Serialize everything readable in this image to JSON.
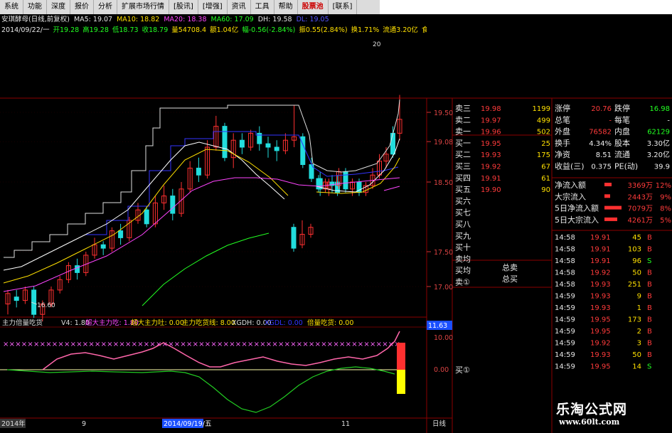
{
  "menu": {
    "items": [
      "系统",
      "功能",
      "深度",
      "报价",
      "分析",
      "扩展市场行情",
      "资讯",
      "",
      "增强",
      "资讯",
      "工具",
      "帮助",
      "股票池",
      ""
    ],
    "visible": [
      "系统",
      "功能",
      "深度",
      "报价",
      "分析",
      "扩展市场行情",
      "[股讯]",
      "[增强]",
      "资讯",
      "工具",
      "帮助",
      "股票池",
      "[联系]"
    ]
  },
  "title": {
    "stock": "安琪酵母(日线,前复权)",
    "ma5": "MA5: 19.07",
    "ma10": "MA10: 18.82",
    "ma20": "MA20: 18.38",
    "ma60": "MA60: 17.09",
    "dh": "DH: 19.58",
    "dl": "DL: 19.05"
  },
  "info": {
    "date": "2014/09/22/一",
    "open": "开19.28",
    "high": "高19.28",
    "low": "低18.73",
    "close": "收18.79",
    "volume": "量54708.4",
    "amount": "额1.04亿",
    "change": "幅-0.56(-2.84%)",
    "amplitude": "振0.55(2.84%)",
    "turnover": "换1.71%",
    "float": "流通3.20亿",
    "sector": "食品",
    "right_num": "20"
  },
  "main_axis": [
    "19.50",
    "19.08",
    "18.50",
    "17.50",
    "17.00"
  ],
  "main_low_label": "16.60",
  "indicator": {
    "name": "主力倍量吃货",
    "v4": "V4: 1.80",
    "l1": "超大主力吃: 1.80",
    "l2": "超大主力吐: 0.00",
    "l3": "主力吃货线: 8.00",
    "l4": "XGDH: 0.00",
    "l5": "XGDL: 0.00",
    "l6": "倍量吃货: 0.00",
    "axis_top": "11.63",
    "axis_mid": "10.00",
    "axis_low": "0.00"
  },
  "order_book": {
    "labels": [
      "卖三",
      "卖二",
      "卖一",
      "买一",
      "买二",
      "买三",
      "买四",
      "买五",
      "买六",
      "买七",
      "买八",
      "买九",
      "买十",
      "卖均",
      "买均",
      "卖①"
    ],
    "prices": [
      "19.98",
      "19.97",
      "19.96",
      "19.95",
      "19.93",
      "19.92",
      "19.91",
      "19.90",
      "",
      "",
      "",
      "",
      "",
      "",
      "",
      ""
    ],
    "volumes": [
      "1199",
      "499",
      "502",
      "25",
      "175",
      "67",
      "61",
      "90",
      "",
      "",
      "",
      "",
      "",
      "",
      "",
      ""
    ],
    "total_sell": "总卖",
    "total_buy": "总买",
    "bottom_buy": "买①"
  },
  "stats": {
    "rows": [
      {
        "k1": "涨停",
        "v1": "20.76",
        "k2": "跌停",
        "v2": "16.98"
      },
      {
        "k1": "总笔",
        "v1": "-",
        "k2": "每笔",
        "v2": "-"
      },
      {
        "k1": "外盘",
        "v1": "76582",
        "k2": "内盘",
        "v2": "62129"
      },
      {
        "k1": "换手",
        "v1": "4.34%",
        "k2": "股本",
        "v2": "3.30亿"
      },
      {
        "k1": "净资",
        "v1": "8.51",
        "k2": "流通",
        "v2": "3.20亿"
      },
      {
        "k1": "收益(三)",
        "v1": "0.375",
        "k2": "PE(动)",
        "v2": "39.9"
      }
    ]
  },
  "flows": [
    {
      "label": "净流入额",
      "value": "3369万",
      "pct": "12%"
    },
    {
      "label": "大宗流入",
      "value": "2443万",
      "pct": "9%"
    },
    {
      "label": "5日净流入额",
      "value": "7079万",
      "pct": "8%"
    },
    {
      "label": "5日大宗流入",
      "value": "4261万",
      "pct": "5%"
    }
  ],
  "ticks": [
    {
      "t": "14:58",
      "p": "19.91",
      "v": "45",
      "s": "B"
    },
    {
      "t": "14:58",
      "p": "19.91",
      "v": "103",
      "s": "B"
    },
    {
      "t": "14:58",
      "p": "19.91",
      "v": "96",
      "s": "S"
    },
    {
      "t": "14:58",
      "p": "19.92",
      "v": "50",
      "s": "B"
    },
    {
      "t": "14:58",
      "p": "19.93",
      "v": "251",
      "s": "B"
    },
    {
      "t": "14:59",
      "p": "19.93",
      "v": "9",
      "s": "B"
    },
    {
      "t": "14:59",
      "p": "19.93",
      "v": "1",
      "s": "B"
    },
    {
      "t": "14:59",
      "p": "19.95",
      "v": "173",
      "s": "B"
    },
    {
      "t": "14:59",
      "p": "19.95",
      "v": "2",
      "s": "B"
    },
    {
      "t": "14:59",
      "p": "19.92",
      "v": "3",
      "s": "B"
    },
    {
      "t": "14:59",
      "p": "19.93",
      "v": "50",
      "s": "B"
    },
    {
      "t": "14:59",
      "p": "19.95",
      "v": "14",
      "s": "S"
    }
  ],
  "bottom": {
    "year": "2014年",
    "month": "9",
    "date": "2014/09/19/五",
    "n11": "11",
    "right": "日线"
  },
  "watermark": {
    "cn": "乐淘公式网",
    "url": "www.60lt.com"
  },
  "colors": {
    "up": "#ff3030",
    "down": "#22dddd",
    "ma5": "#ffffff",
    "ma10": "#ffe000",
    "ma20": "#ff44ff",
    "ma60": "#22ff22",
    "grid": "#8b0000"
  }
}
